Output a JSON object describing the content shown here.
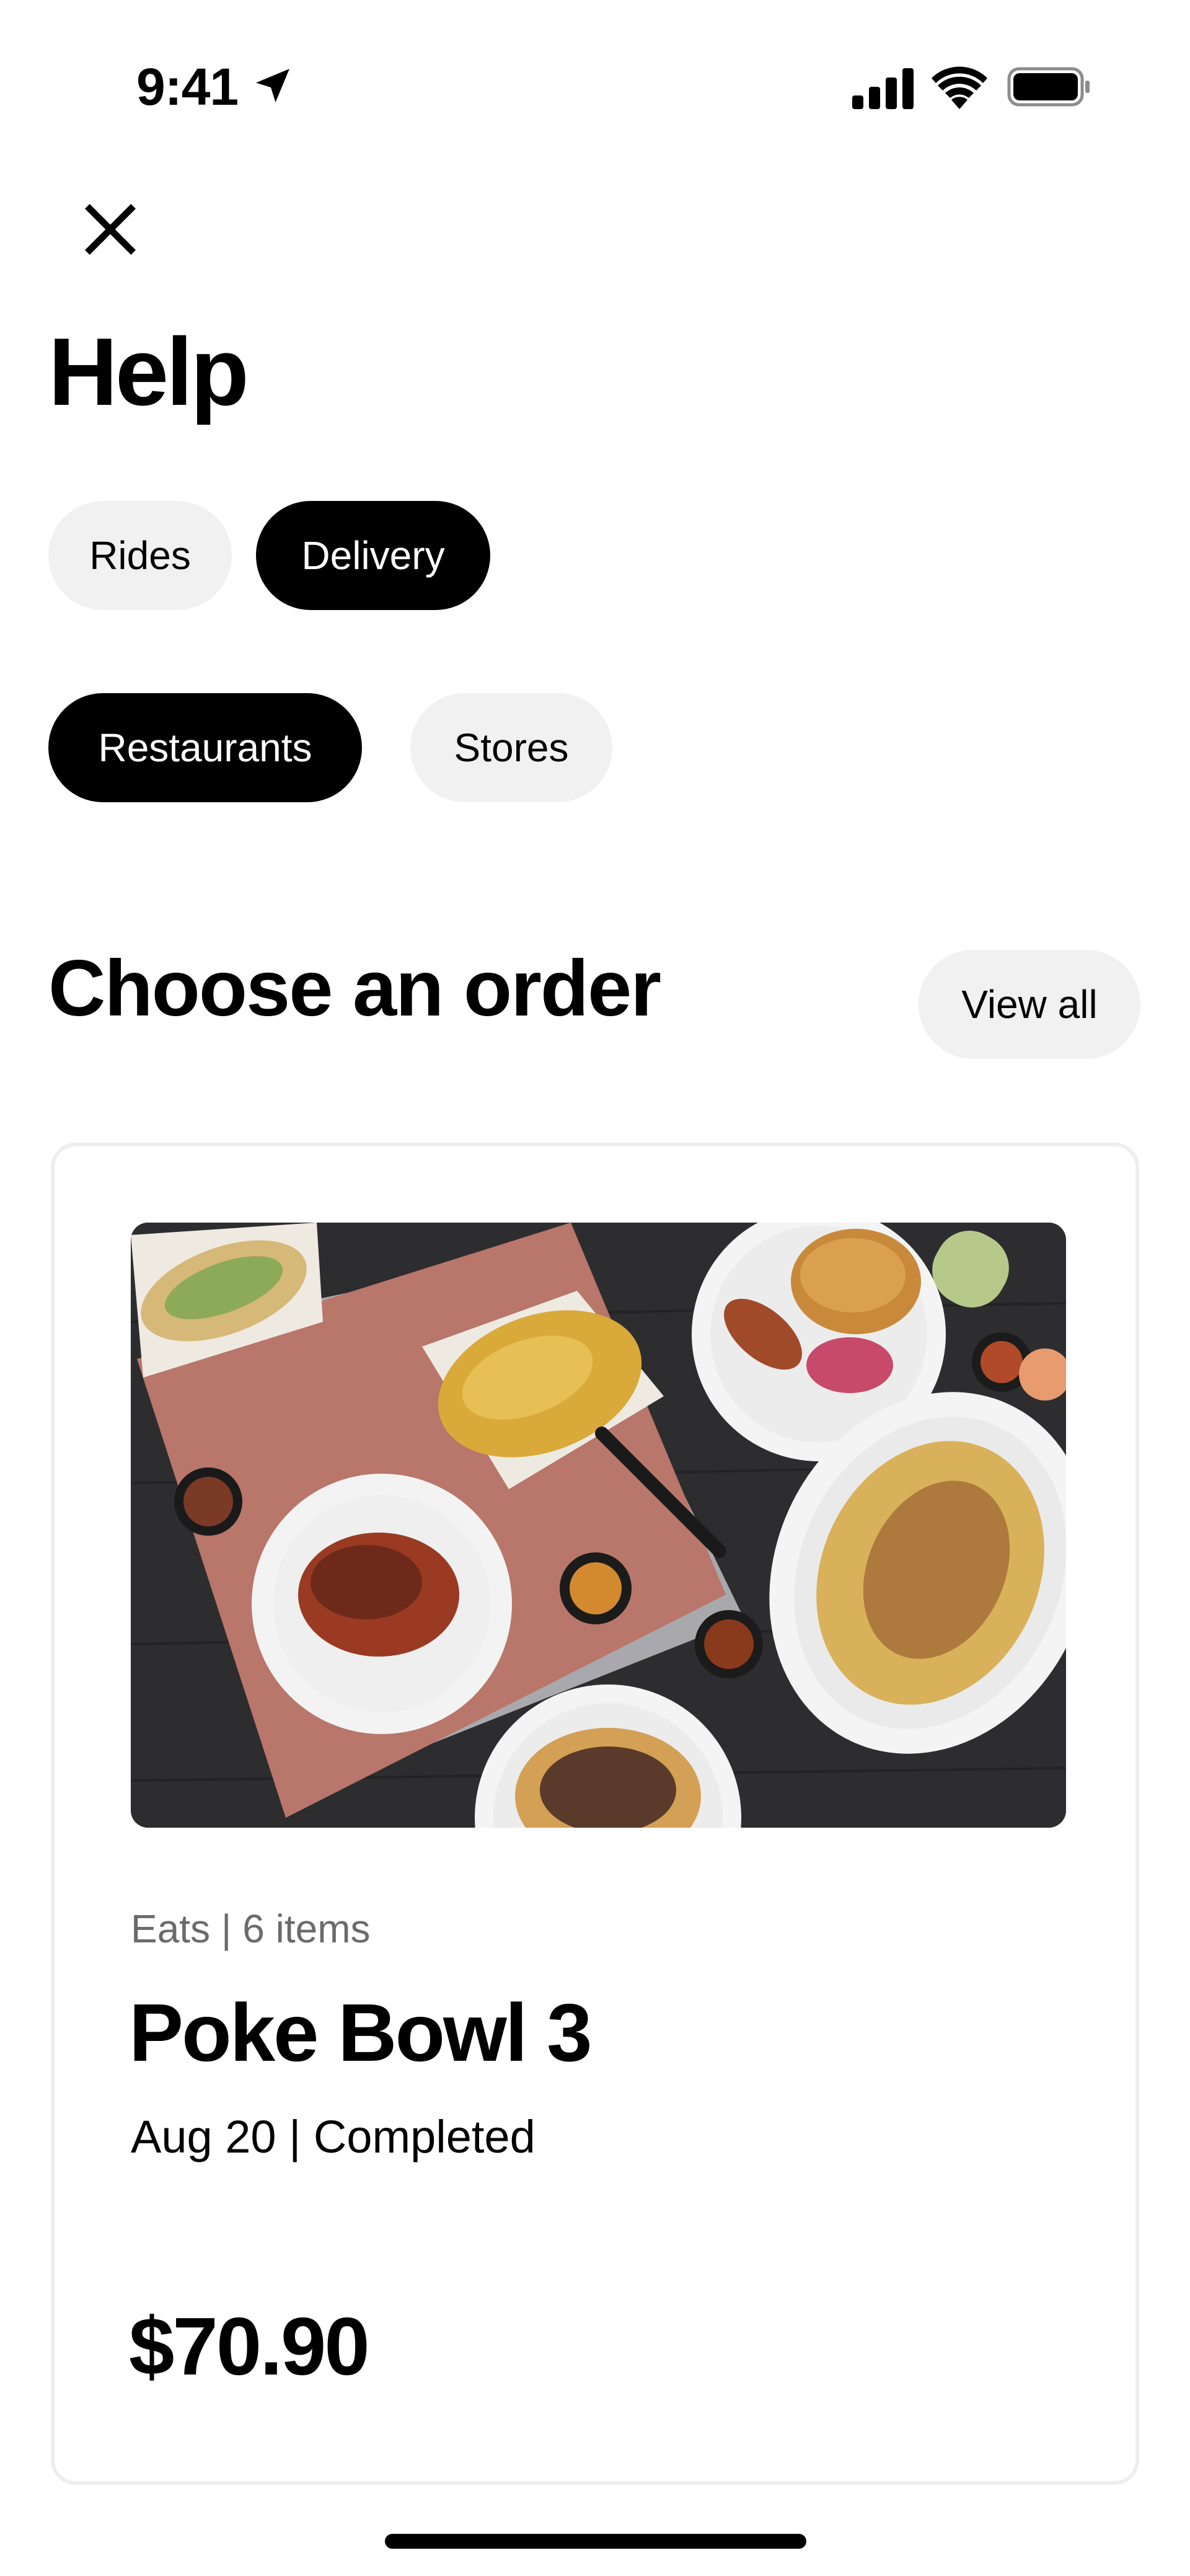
{
  "status_bar": {
    "time": "9:41",
    "icons": [
      "location-arrow-icon",
      "cellular-signal-icon",
      "wifi-icon",
      "battery-icon"
    ]
  },
  "header": {
    "close_icon": "close-icon",
    "title": "Help"
  },
  "service_tabs": [
    {
      "label": "Rides",
      "active": false
    },
    {
      "label": "Delivery",
      "active": true
    }
  ],
  "delivery_tabs": [
    {
      "label": "Restaurants",
      "active": true
    },
    {
      "label": "Stores",
      "active": false
    }
  ],
  "orders_section": {
    "title": "Choose an order",
    "view_all_label": "View all"
  },
  "order": {
    "meta": "Eats | 6 items",
    "name": "Poke Bowl 3",
    "status": "Aug 20 | Completed",
    "price": "$70.90"
  },
  "colors": {
    "primary": "#000000",
    "chip_inactive": "#f1f1f1",
    "secondary_text": "#6b6b6b",
    "card_border": "#eeeeee"
  }
}
